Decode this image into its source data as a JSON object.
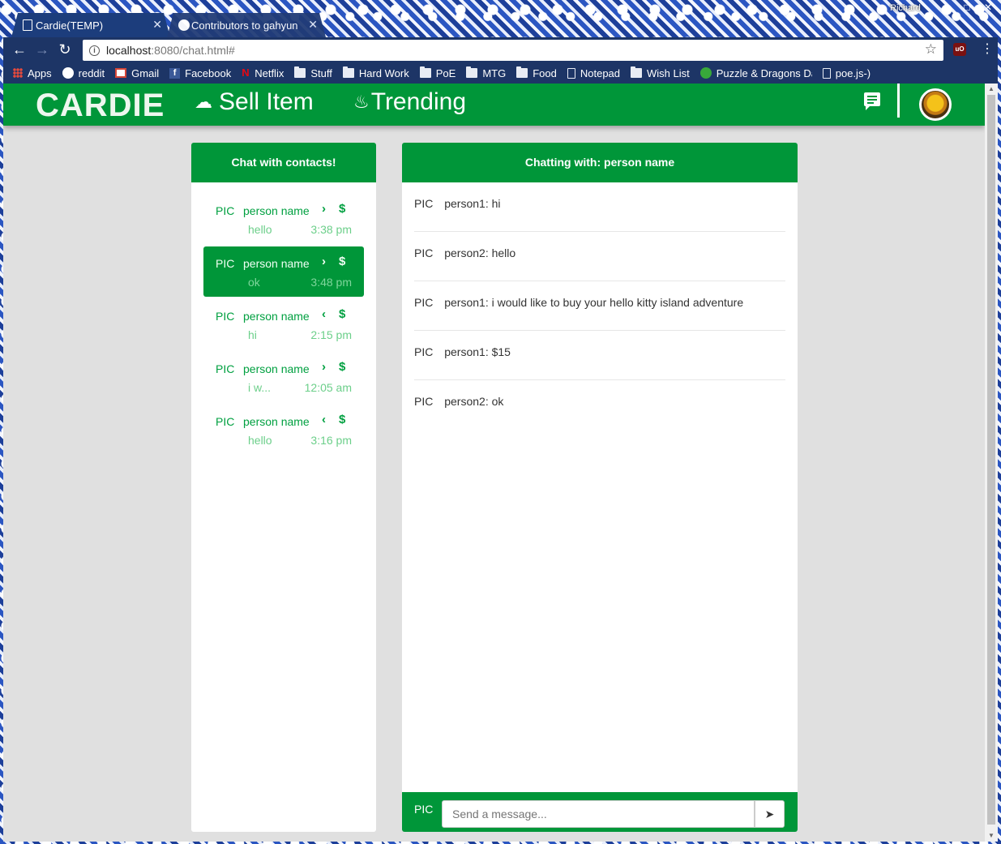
{
  "browser": {
    "tabs": [
      {
        "title": "Cardie(TEMP)",
        "active": true
      },
      {
        "title": "Contributors to gahyun",
        "active": false
      }
    ],
    "user": "Richard",
    "url_host": "localhost",
    "url_path": ":8080/chat.html#",
    "bookmarks": [
      {
        "label": "Apps",
        "icon": "apps-icon"
      },
      {
        "label": "reddit",
        "icon": "reddit-icon"
      },
      {
        "label": "Gmail",
        "icon": "gmail-icon"
      },
      {
        "label": "Facebook",
        "icon": "facebook-icon"
      },
      {
        "label": "Netflix",
        "icon": "netflix-icon"
      },
      {
        "label": "Stuff",
        "icon": "folder-icon"
      },
      {
        "label": "Hard Work",
        "icon": "folder-icon"
      },
      {
        "label": "PoE",
        "icon": "folder-icon"
      },
      {
        "label": "MTG",
        "icon": "folder-icon"
      },
      {
        "label": "Food",
        "icon": "folder-icon"
      },
      {
        "label": "Notepad",
        "icon": "page-icon"
      },
      {
        "label": "Wish List",
        "icon": "folder-icon"
      },
      {
        "label": "Puzzle & Dragons Da",
        "icon": "puzzle-dragons-icon"
      },
      {
        "label": "poe.js-)",
        "icon": "page-icon"
      }
    ]
  },
  "app": {
    "logo": "CARDIE",
    "nav": {
      "sell_item": "Sell Item",
      "trending": "Trending"
    },
    "colors": {
      "primary": "#009639",
      "muted_text": "#6ccf8a",
      "background": "#e0e0e0"
    }
  },
  "contacts_panel": {
    "title": "Chat with contacts!",
    "contacts": [
      {
        "pic": "PIC",
        "name": "person name",
        "direction": "›",
        "dollar": "$",
        "message": "hello",
        "time": "3:38 pm",
        "selected": false
      },
      {
        "pic": "PIC",
        "name": "person name",
        "direction": "›",
        "dollar": "$",
        "message": "ok",
        "time": "3:48 pm",
        "selected": true
      },
      {
        "pic": "PIC",
        "name": "person name",
        "direction": "‹",
        "dollar": "$",
        "message": "hi",
        "time": "2:15 pm",
        "selected": false
      },
      {
        "pic": "PIC",
        "name": "person name",
        "direction": "›",
        "dollar": "$",
        "message": "i w...",
        "time": "12:05 am",
        "selected": false
      },
      {
        "pic": "PIC",
        "name": "person name",
        "direction": "‹",
        "dollar": "$",
        "message": "hello",
        "time": "3:16 pm",
        "selected": false
      }
    ]
  },
  "chat_panel": {
    "title": "Chatting with: person name",
    "messages": [
      {
        "pic": "PIC",
        "text": "person1: hi"
      },
      {
        "pic": "PIC",
        "text": "person2: hello"
      },
      {
        "pic": "PIC",
        "text": "person1: i would like to buy your hello kitty island adventure"
      },
      {
        "pic": "PIC",
        "text": "person1: $15"
      },
      {
        "pic": "PIC",
        "text": "person2: ok"
      }
    ],
    "composer": {
      "pic": "PIC",
      "placeholder": "Send a message..."
    }
  }
}
